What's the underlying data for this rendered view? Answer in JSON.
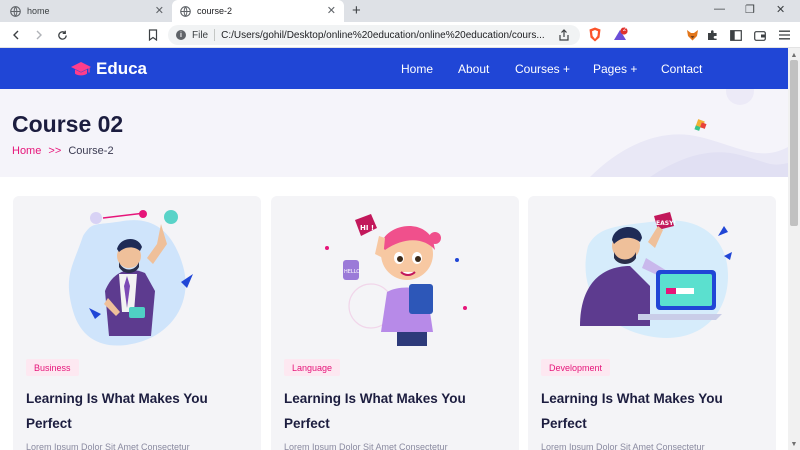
{
  "browser": {
    "tabs": [
      {
        "label": "home"
      },
      {
        "label": "course-2"
      }
    ],
    "new_tab": "+",
    "window_controls": {
      "minimize": "—",
      "restore": "❐",
      "close": "✕"
    },
    "address": {
      "scheme_label": "File",
      "url": "C:/Users/gohil/Desktop/online%20education/online%20education/cours..."
    },
    "shield_badge": "2",
    "icons": [
      "back-icon",
      "forward-icon",
      "reload-icon",
      "bookmark-icon",
      "info-icon",
      "share-icon",
      "brave-shield-icon",
      "rewards-icon",
      "fox-extension-icon",
      "puzzle-icon",
      "sidebar-icon",
      "wallet-icon",
      "menu-icon"
    ]
  },
  "site": {
    "logo_text": "Educa",
    "nav": [
      {
        "label": "Home"
      },
      {
        "label": "About"
      },
      {
        "label": "Courses +"
      },
      {
        "label": "Pages +"
      },
      {
        "label": "Contact"
      }
    ],
    "colors": {
      "nav_bg": "#2046d6",
      "accent": "#e6157a",
      "heading": "#1c1d3f"
    }
  },
  "hero": {
    "title": "Course 02",
    "breadcrumb": {
      "home": "Home",
      "separator": ">>",
      "current": "Course-2"
    }
  },
  "courses": [
    {
      "tag": "Business",
      "title": "Learning Is What Makes You Perfect",
      "desc": "Lorem Ipsum Dolor Sit Amet Consectetur"
    },
    {
      "tag": "Language",
      "title": "Learning Is What Makes You Perfect",
      "desc": "Lorem Ipsum Dolor Sit Amet Consectetur"
    },
    {
      "tag": "Development",
      "title": "Learning Is What Makes You Perfect",
      "desc": "Lorem Ipsum Dolor Sit Amet Consectetur"
    }
  ],
  "illustration_text": {
    "bubble_one": "HI !",
    "bubble_two": "HELLO",
    "bubble_three": "EASY!"
  }
}
